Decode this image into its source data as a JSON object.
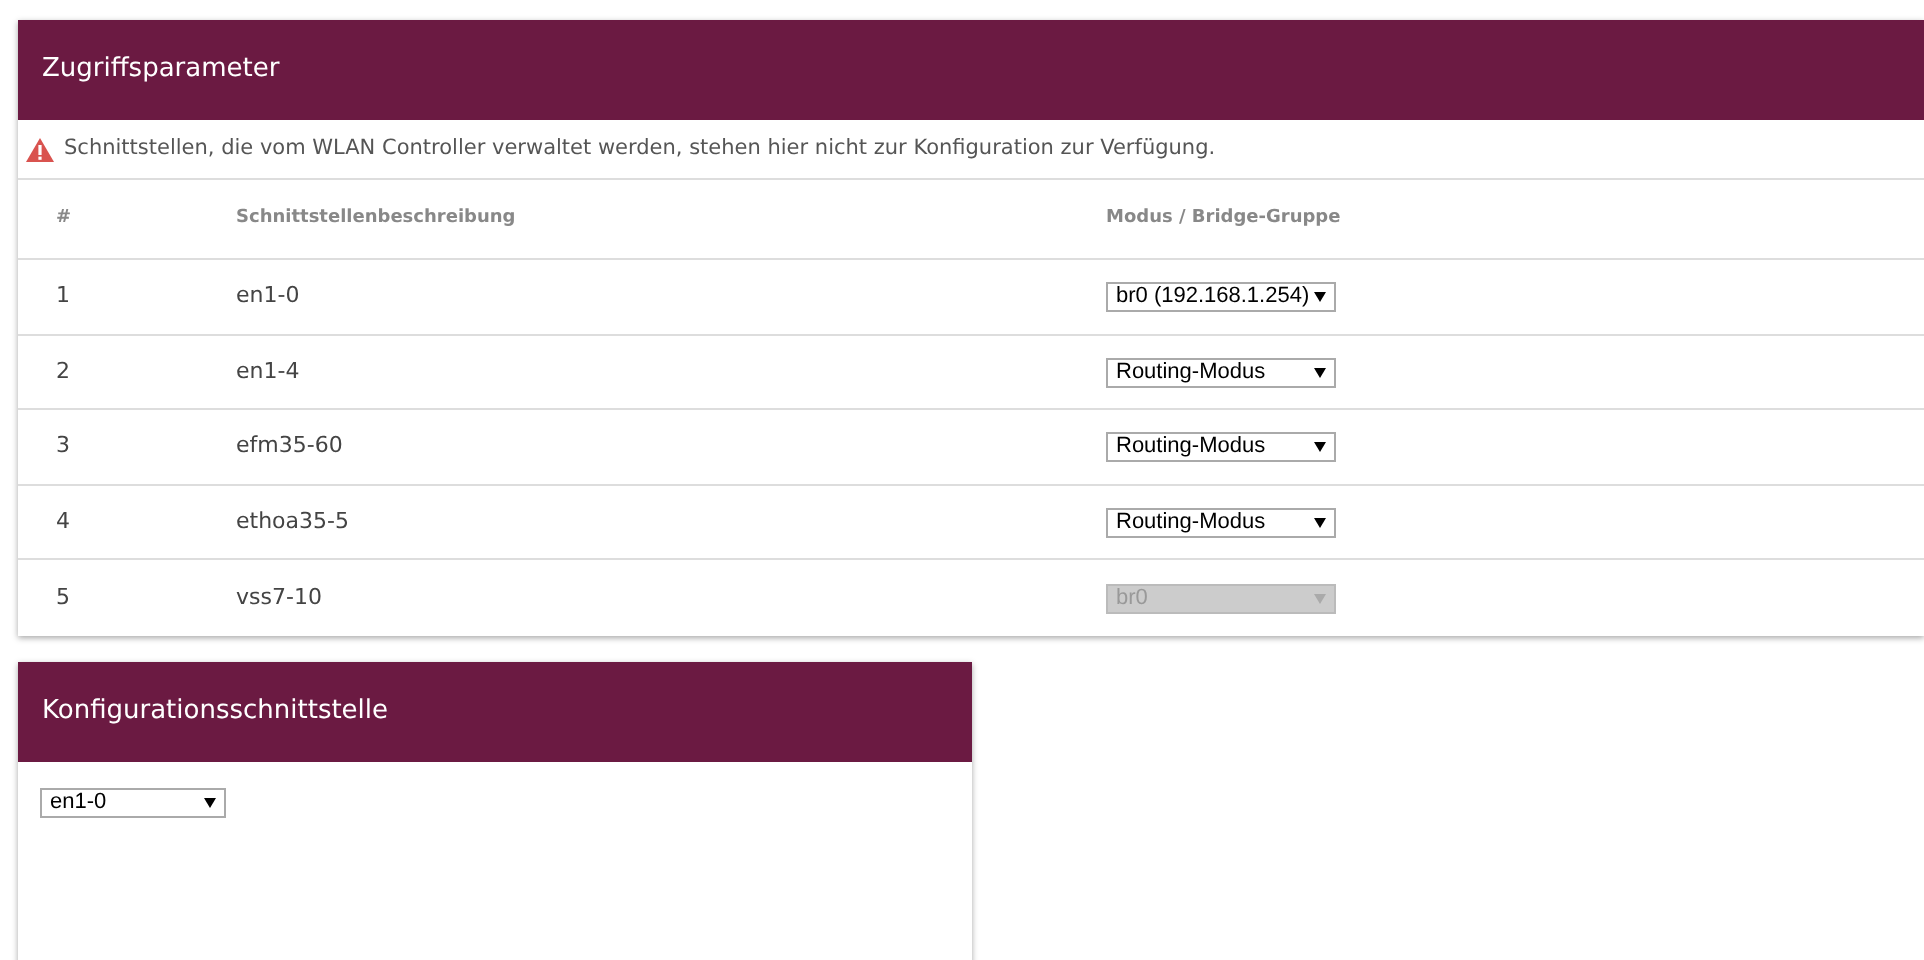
{
  "access_panel": {
    "title": "Zugriffsparameter",
    "warning": "Schnittstellen, die vom WLAN Controller verwaltet werden, stehen hier nicht zur Konfiguration zur Verfügung.",
    "table": {
      "columns": [
        "#",
        "Schnittstellenbeschreibung",
        "Modus / Bridge-Gruppe"
      ],
      "rows": [
        {
          "index": "1",
          "interface": "en1-0",
          "mode": "br0 (192.168.1.254)",
          "disabled": false
        },
        {
          "index": "2",
          "interface": "en1-4",
          "mode": "Routing-Modus",
          "disabled": false
        },
        {
          "index": "3",
          "interface": "efm35-60",
          "mode": "Routing-Modus",
          "disabled": false
        },
        {
          "index": "4",
          "interface": "ethoa35-5",
          "mode": "Routing-Modus",
          "disabled": false
        },
        {
          "index": "5",
          "interface": "vss7-10",
          "mode": "br0",
          "disabled": true
        }
      ]
    }
  },
  "config_panel": {
    "title": "Konfigurationsschnittstelle",
    "interface": "en1-0"
  }
}
